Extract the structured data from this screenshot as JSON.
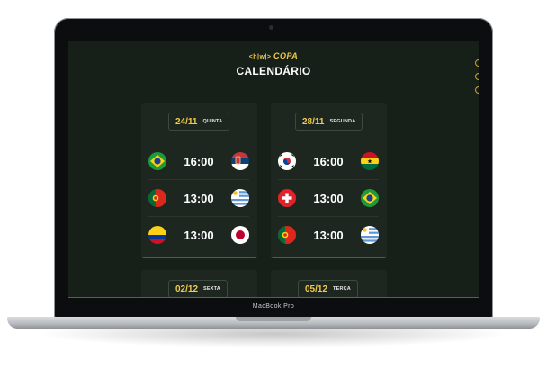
{
  "device": {
    "label": "MacBook Pro"
  },
  "header": {
    "logo_prefix": "<h|w|>",
    "logo_text": "COPA",
    "title": "CALENDÁRIO"
  },
  "cards": [
    {
      "date": "24/11",
      "weekday": "QUINTA",
      "matches": [
        {
          "home": "Brazil",
          "time": "16:00",
          "away": "Serbia"
        },
        {
          "home": "Portugal",
          "time": "13:00",
          "away": "Uruguay"
        },
        {
          "home": "Colombia",
          "time": "13:00",
          "away": "Japan"
        }
      ]
    },
    {
      "date": "28/11",
      "weekday": "SEGUNDA",
      "matches": [
        {
          "home": "South Korea",
          "time": "16:00",
          "away": "Ghana"
        },
        {
          "home": "Switzerland",
          "time": "13:00",
          "away": "Brazil"
        },
        {
          "home": "Portugal",
          "time": "13:00",
          "away": "Uruguay"
        }
      ]
    },
    {
      "date": "02/12",
      "weekday": "SEXTA",
      "matches": []
    },
    {
      "date": "05/12",
      "weekday": "TERÇA",
      "matches": []
    }
  ],
  "colors": {
    "accent": "#f2c94c",
    "background": "#172018",
    "card": "#1d261f"
  }
}
